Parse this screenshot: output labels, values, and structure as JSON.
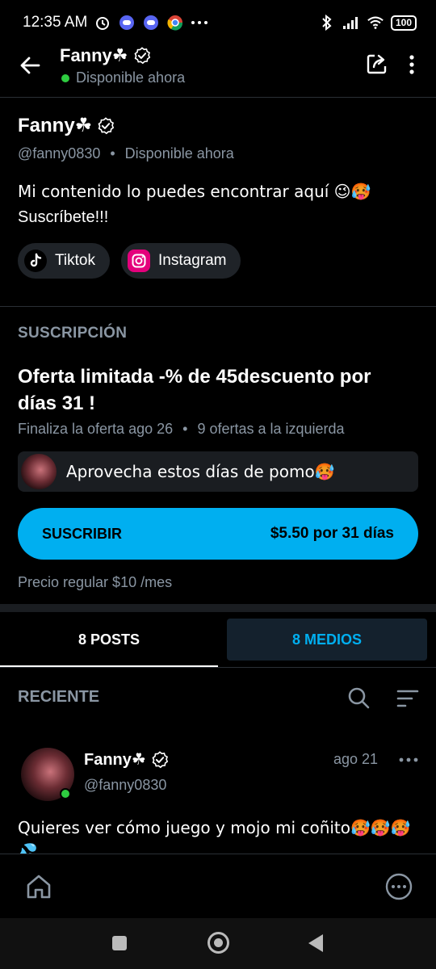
{
  "status_bar": {
    "time": "12:35 AM",
    "battery": "100"
  },
  "header": {
    "name": "Fanny☘",
    "status": "Disponible ahora"
  },
  "profile": {
    "name": "Fanny☘",
    "handle": "@fanny0830",
    "separator": "•",
    "availability": "Disponible ahora",
    "bio_line1": "Mi contenido lo puedes encontrar aquí 😉🥵",
    "bio_line2": "Suscríbete!!!",
    "links": [
      {
        "label": "Tiktok"
      },
      {
        "label": "Instagram"
      }
    ]
  },
  "subscription": {
    "heading": "SUSCRIPCIÓN",
    "offer_title": "Oferta limitada -% de 45descuento por días 31 !",
    "offer_ends": "Finaliza la oferta ago 26",
    "separator": "•",
    "offers_left": "9 ofertas a la izquierda",
    "promo_text": "Aprovecha estos días de pomo🥵",
    "button_label": "SUSCRIBIR",
    "button_price": "$5.50 por 31 días",
    "regular_price": "Precio regular $10 /mes"
  },
  "tabs": [
    {
      "label": "8 POSTS"
    },
    {
      "label": "8 MEDIOS"
    }
  ],
  "recent": {
    "label": "RECIENTE"
  },
  "post": {
    "name": "Fanny☘",
    "handle": "@fanny0830",
    "date": "ago 21",
    "text": "Quieres ver cómo juego y mojo mi coñito🥵🥵🥵 💦"
  },
  "colors": {
    "accent": "#00aff0",
    "online": "#2ecc40",
    "muted": "#8a96a3"
  }
}
